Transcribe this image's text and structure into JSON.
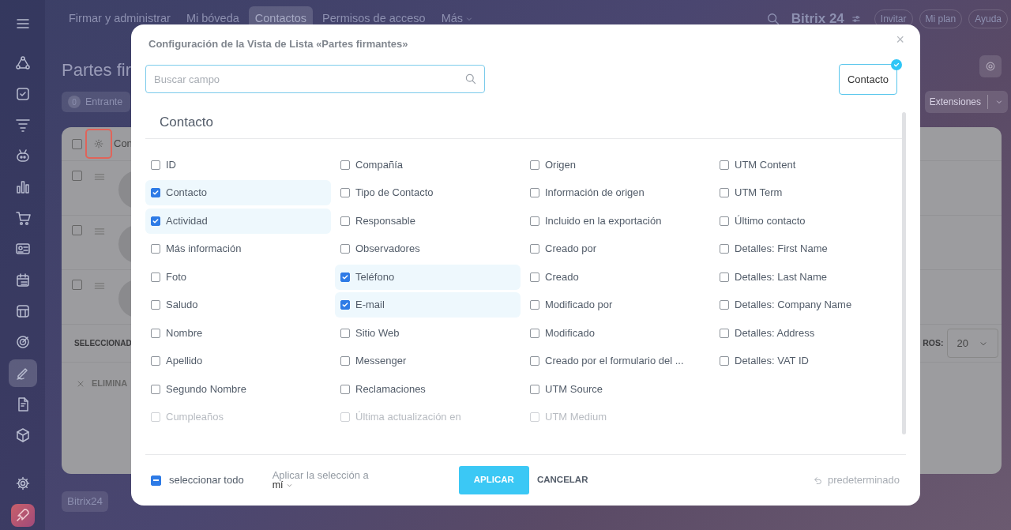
{
  "topbar": {
    "nav": [
      {
        "label": "Firmar y administrar",
        "selected": false
      },
      {
        "label": "Mi bóveda",
        "selected": false
      },
      {
        "label": "Contactos",
        "selected": true
      },
      {
        "label": "Permisos de acceso",
        "selected": false
      }
    ],
    "more": "Más",
    "logo": "Bitrix 24",
    "buttons": [
      "Invitar",
      "Mi plan",
      "Ayuda"
    ]
  },
  "sidebar": {
    "items": [
      {
        "kind": "nodes",
        "selected": false
      },
      {
        "kind": "task",
        "selected": false
      },
      {
        "kind": "funnel",
        "selected": false
      },
      {
        "kind": "robot",
        "selected": false
      },
      {
        "kind": "chart",
        "selected": false
      },
      {
        "kind": "cart",
        "selected": false
      },
      {
        "kind": "card",
        "selected": false
      },
      {
        "kind": "calendar",
        "selected": false
      },
      {
        "kind": "store",
        "selected": false
      },
      {
        "kind": "target",
        "selected": false
      },
      {
        "kind": "pen",
        "selected": true
      },
      {
        "kind": "doc",
        "selected": false
      },
      {
        "kind": "box",
        "selected": false
      }
    ]
  },
  "page": {
    "title": "Partes fir",
    "filter": {
      "count": "0",
      "label": "Entrante"
    },
    "extensions": "Extensiones",
    "grid": {
      "header": "Con",
      "header_checked": false,
      "rows": [
        {
          "checked": false
        },
        {
          "checked": false
        },
        {
          "checked": false
        }
      ],
      "selected_label": "SELECCIONAD",
      "delete_label": "ELIMINA",
      "page_size_label": "ROS:",
      "page_size": "20"
    },
    "brand": "Bitrix24"
  },
  "dialog": {
    "title": "Configuración de la Vista de Lista «Partes firmantes»",
    "close": "×",
    "search": {
      "placeholder": "Buscar campo"
    },
    "entities": [
      {
        "label": "Contacto",
        "selected": true
      }
    ],
    "section_title": "Contacto",
    "columns": [
      [
        {
          "label": "ID",
          "checked": false,
          "disabled": false
        },
        {
          "label": "Contacto",
          "checked": true,
          "disabled": false
        },
        {
          "label": "Actividad",
          "checked": true,
          "disabled": false
        },
        {
          "label": "Más información",
          "checked": false,
          "disabled": false
        },
        {
          "label": "Foto",
          "checked": false,
          "disabled": false
        },
        {
          "label": "Saludo",
          "checked": false,
          "disabled": false
        },
        {
          "label": "Nombre",
          "checked": false,
          "disabled": false
        },
        {
          "label": "Apellido",
          "checked": false,
          "disabled": false
        },
        {
          "label": "Segundo Nombre",
          "checked": false,
          "disabled": false
        },
        {
          "label": "Cumpleaños",
          "checked": false,
          "disabled": true
        }
      ],
      [
        {
          "label": "Compañía",
          "checked": false,
          "disabled": false
        },
        {
          "label": "Tipo de Contacto",
          "checked": false,
          "disabled": false
        },
        {
          "label": "Responsable",
          "checked": false,
          "disabled": false
        },
        {
          "label": "Observadores",
          "checked": false,
          "disabled": false
        },
        {
          "label": "Teléfono",
          "checked": true,
          "disabled": false
        },
        {
          "label": "E-mail",
          "checked": true,
          "disabled": false
        },
        {
          "label": "Sitio Web",
          "checked": false,
          "disabled": false
        },
        {
          "label": "Messenger",
          "checked": false,
          "disabled": false
        },
        {
          "label": "Reclamaciones",
          "checked": false,
          "disabled": false
        },
        {
          "label": "Última actualización en",
          "checked": false,
          "disabled": true
        }
      ],
      [
        {
          "label": "Origen",
          "checked": false,
          "disabled": false
        },
        {
          "label": "Información de origen",
          "checked": false,
          "disabled": false
        },
        {
          "label": "Incluido en la exportación",
          "checked": false,
          "disabled": false
        },
        {
          "label": "Creado por",
          "checked": false,
          "disabled": false
        },
        {
          "label": "Creado",
          "checked": false,
          "disabled": false
        },
        {
          "label": "Modificado por",
          "checked": false,
          "disabled": false
        },
        {
          "label": "Modificado",
          "checked": false,
          "disabled": false
        },
        {
          "label": "Creado por el formulario del ...",
          "checked": false,
          "disabled": false
        },
        {
          "label": "UTM Source",
          "checked": false,
          "disabled": false
        },
        {
          "label": "UTM Medium",
          "checked": false,
          "disabled": true
        }
      ],
      [
        {
          "label": "UTM Content",
          "checked": false,
          "disabled": false
        },
        {
          "label": "UTM Term",
          "checked": false,
          "disabled": false
        },
        {
          "label": "Último contacto",
          "checked": false,
          "disabled": false
        },
        {
          "label": "Detalles: First Name",
          "checked": false,
          "disabled": false
        },
        {
          "label": "Detalles: Last Name",
          "checked": false,
          "disabled": false
        },
        {
          "label": "Detalles: Company Name",
          "checked": false,
          "disabled": false
        },
        {
          "label": "Detalles: Address",
          "checked": false,
          "disabled": false
        },
        {
          "label": "Detalles: VAT ID",
          "checked": false,
          "disabled": false
        }
      ]
    ],
    "select_all": {
      "label": "seleccionar todo",
      "indeterminate": true
    },
    "apply_to": {
      "label": "Aplicar la selección a",
      "value": "mí"
    },
    "apply": "APLICAR",
    "cancel": "CANCELAR",
    "reset": "predeterminado"
  }
}
